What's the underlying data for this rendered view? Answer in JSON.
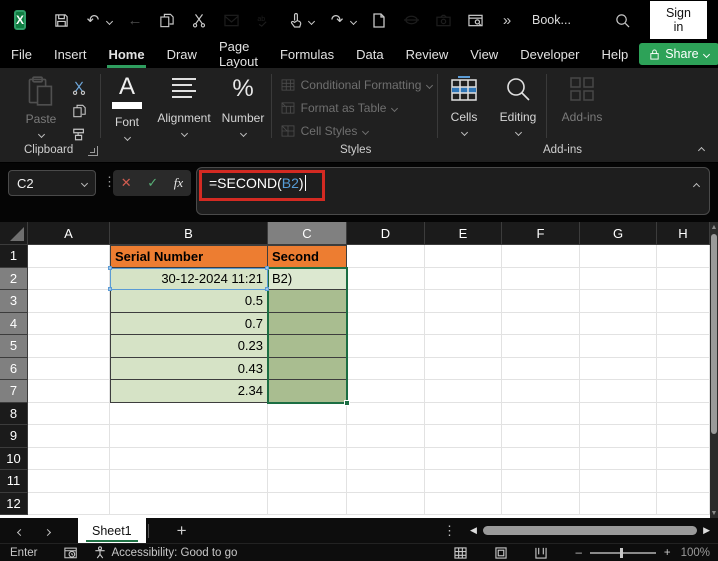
{
  "titlebar": {
    "workbook_name": "Book...",
    "sign_in": "Sign in",
    "quick_access_icons": [
      "save",
      "undo",
      "back",
      "copy",
      "cut",
      "email",
      "spelling",
      "touch-mode",
      "redo",
      "new-file",
      "strikethrough",
      "camera",
      "preview-pane",
      "more-commands"
    ],
    "glyphs": {
      "undo": "↶",
      "redo": "↷",
      "back": "←",
      "more": "»",
      "minimize": "–",
      "maximize": "☐",
      "close": "✕",
      "dots": "⋮"
    }
  },
  "menubar": {
    "tabs": [
      {
        "label": "File"
      },
      {
        "label": "Insert"
      },
      {
        "label": "Home",
        "active": true
      },
      {
        "label": "Draw"
      },
      {
        "label": "Page Layout"
      },
      {
        "label": "Formulas"
      },
      {
        "label": "Data"
      },
      {
        "label": "Review"
      },
      {
        "label": "View"
      },
      {
        "label": "Developer"
      },
      {
        "label": "Help"
      }
    ],
    "share_label": "Share"
  },
  "ribbon": {
    "paste_label": "Paste",
    "clipboard_group": "Clipboard",
    "font_label": "Font",
    "font_glyph": "A",
    "alignment_label": "Alignment",
    "number_label": "Number",
    "number_glyph": "%",
    "conditional_formatting": "Conditional Formatting",
    "format_as_table": "Format as Table",
    "cell_styles": "Cell Styles",
    "styles_group": "Styles",
    "cells_label": "Cells",
    "editing_label": "Editing",
    "addins_label": "Add-ins",
    "addins_group": "Add-ins"
  },
  "formula": {
    "name_box": "C2",
    "cancel_glyph": "✕",
    "commit_glyph": "✓",
    "fx_glyph": "fx",
    "part1": "=SECOND(",
    "ref": "B2",
    "part2": ")"
  },
  "grid": {
    "columns": [
      "A",
      "B",
      "C",
      "D",
      "E",
      "F",
      "G",
      "H"
    ],
    "active_column": "C",
    "active_rows": [
      2,
      3,
      4,
      5,
      6,
      7
    ],
    "row_count": 12,
    "cells": [
      {
        "col": "B",
        "row": 1,
        "text": "Serial Number",
        "style": "header",
        "align": "left"
      },
      {
        "col": "C",
        "row": 1,
        "text": "Second",
        "style": "header",
        "align": "left"
      },
      {
        "col": "B",
        "row": 2,
        "text": "30-12-2024 11:21",
        "style": "data",
        "align": "right"
      },
      {
        "col": "C",
        "row": 2,
        "text": "B2)",
        "style": "editing",
        "align": "left"
      },
      {
        "col": "B",
        "row": 3,
        "text": "0.5",
        "style": "data",
        "align": "right"
      },
      {
        "col": "C",
        "row": 3,
        "text": "",
        "style": "selected",
        "align": "left"
      },
      {
        "col": "B",
        "row": 4,
        "text": "0.7",
        "style": "data",
        "align": "right"
      },
      {
        "col": "C",
        "row": 4,
        "text": "",
        "style": "selected",
        "align": "left"
      },
      {
        "col": "B",
        "row": 5,
        "text": "0.23",
        "style": "data",
        "align": "right"
      },
      {
        "col": "C",
        "row": 5,
        "text": "",
        "style": "selected",
        "align": "left"
      },
      {
        "col": "B",
        "row": 6,
        "text": "0.43",
        "style": "data",
        "align": "right"
      },
      {
        "col": "C",
        "row": 6,
        "text": "",
        "style": "selected",
        "align": "left"
      },
      {
        "col": "B",
        "row": 7,
        "text": "2.34",
        "style": "data",
        "align": "right"
      },
      {
        "col": "C",
        "row": 7,
        "text": "",
        "style": "selected",
        "align": "left"
      }
    ],
    "bordered_range": {
      "col_start": "B",
      "col_end": "C",
      "row_start": 1,
      "row_end": 7
    },
    "selection": {
      "col": "C",
      "row_start": 2,
      "row_end": 7
    },
    "reference_cell": {
      "col": "B",
      "row": 2
    },
    "colors": {
      "header_fill": "#ED7D31",
      "data_fill": "#D6E3C6",
      "selected_fill": "#A9BD90",
      "selection_border": "#1B6E43",
      "reference_border": "#5B9BD5",
      "annotation_border": "#D32A22",
      "formula_ref_text": "#569CD6"
    }
  },
  "sheetbar": {
    "sheet_name": "Sheet1",
    "add_glyph": "+",
    "prev_arrow": "◀",
    "next_arrow": "▶"
  },
  "statusbar": {
    "mode": "Enter",
    "accessibility": "Accessibility: Good to go",
    "zoom_out_glyph": "–",
    "zoom_in_glyph": "+",
    "zoom_level": "100%"
  }
}
